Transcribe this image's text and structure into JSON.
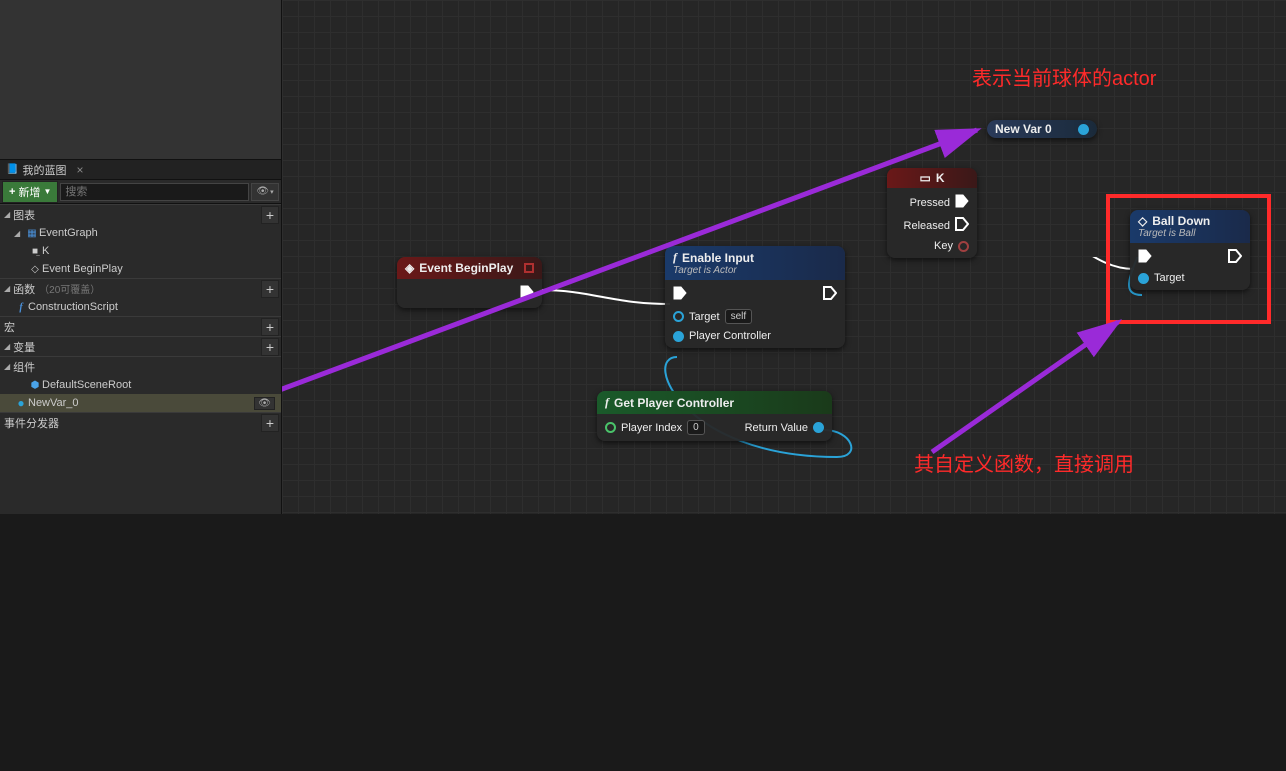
{
  "sidebar": {
    "tab_title": "我的蓝图",
    "add_button": "新增",
    "search_placeholder": "搜索",
    "sections": {
      "graph": {
        "label": "图表"
      },
      "functions": {
        "label": "函数",
        "subtitle": "（20可覆盖）"
      },
      "macros": {
        "label": "宏"
      },
      "variables": {
        "label": "变量"
      },
      "components": {
        "label": "组件"
      },
      "dispatchers": {
        "label": "事件分发器"
      }
    },
    "tree": {
      "eventgraph": "EventGraph",
      "k": "K",
      "beginplay": "Event BeginPlay",
      "construction": "ConstructionScript",
      "defaultscene": "DefaultSceneRoot",
      "newvar": "NewVar_0"
    }
  },
  "nodes": {
    "beginplay": {
      "title": "Event BeginPlay"
    },
    "enableinput": {
      "title": "Enable Input",
      "subtitle": "Target is Actor",
      "target": "Target",
      "self": "self",
      "playercontroller": "Player Controller"
    },
    "getpc": {
      "title": "Get Player Controller",
      "playerindex": "Player Index",
      "playerindex_val": "0",
      "returnvalue": "Return Value"
    },
    "k": {
      "title": "K",
      "pressed": "Pressed",
      "released": "Released",
      "key": "Key"
    },
    "newvar": {
      "title": "New Var 0"
    },
    "balldown": {
      "title": "Ball Down",
      "subtitle": "Target is Ball",
      "target": "Target"
    }
  },
  "annotations": {
    "top": "表示当前球体的actor",
    "bottom": "其自定义函数，直接调用"
  }
}
